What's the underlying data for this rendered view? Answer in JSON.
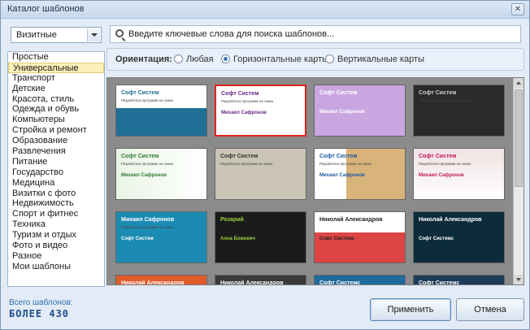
{
  "window": {
    "title": "Каталог шаблонов",
    "close": "✕"
  },
  "category_select": {
    "value": "Визитные"
  },
  "categories": [
    "Простые",
    "Универсальные",
    "Транспорт",
    "Детские",
    "Красота, стиль",
    "Одежда и обувь",
    "Компьютеры",
    "Стройка и ремонт",
    "Образование",
    "Развлечения",
    "Питание",
    "Государство",
    "Медицина",
    "Визитки с фото",
    "Недвижимость",
    "Спорт и фитнес",
    "Техника",
    "Туризм и отдых",
    "Фото и видео",
    "Разное",
    "Мои шаблоны"
  ],
  "selected_category": "Универсальные",
  "search": {
    "placeholder": "Введите ключевые слова для поиска шаблонов..."
  },
  "orientation": {
    "label": "Ориентация:",
    "options": [
      "Любая",
      "Горизонтальные карты",
      "Вертикальные карты"
    ],
    "selected": "Горизонтальные карты"
  },
  "cards": [
    {
      "title": "Софт Систем",
      "subtitle": "Разработка программ на заказ",
      "name": "Михаил Сафронов"
    },
    {
      "title": "Софт Систем",
      "subtitle": "Разработка программ на заказ",
      "name": "Михаил Сафронов"
    },
    {
      "title": "Софт Систем",
      "subtitle": "",
      "name": "Михаил Сафронов"
    },
    {
      "title": "Софт Систем",
      "subtitle": "Разработка программ на заказ",
      "name": ""
    },
    {
      "title": "Софт Систем",
      "subtitle": "Разработка программ на заказ",
      "name": "Михаил Сафронов"
    },
    {
      "title": "Софт Систем",
      "subtitle": "Разработка программ на заказ",
      "name": ""
    },
    {
      "title": "Софт Систем",
      "subtitle": "Разработка программ на заказ",
      "name": "Михаил Сафронов"
    },
    {
      "title": "Софт Систем",
      "subtitle": "Разработка программ на заказ",
      "name": "Михаил Сафронов"
    },
    {
      "title": "Михаил Сафронов",
      "subtitle": "Разработка программ на заказ",
      "name": "Софт Систем"
    },
    {
      "title": "Розарий",
      "subtitle": "",
      "name": "Анна Божевич"
    },
    {
      "title": "Николай Александров",
      "subtitle": "",
      "name": "Софт Системс"
    },
    {
      "title": "Николай Александров",
      "subtitle": "",
      "name": "Софт Системс"
    },
    {
      "title": "Николай Александров",
      "subtitle": "",
      "name": ""
    },
    {
      "title": "Николай Александров",
      "subtitle": "",
      "name": ""
    },
    {
      "title": "Софт Системс",
      "subtitle": "",
      "name": ""
    },
    {
      "title": "Софт Системс",
      "subtitle": "",
      "name": ""
    }
  ],
  "footer": {
    "total_label": "Всего шаблонов:",
    "total_value": "БОЛЕЕ 430",
    "apply": "Применить",
    "cancel": "Отмена"
  }
}
